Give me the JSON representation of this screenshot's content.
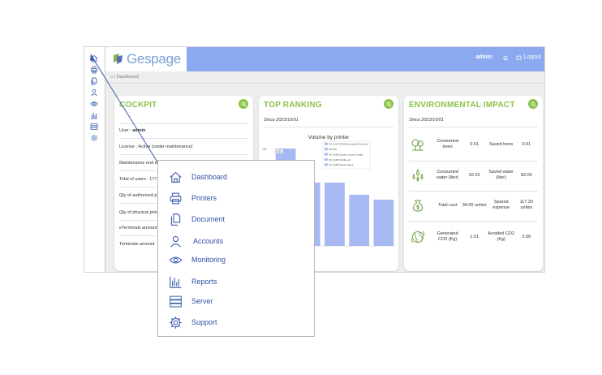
{
  "app": {
    "brand": "Gespage",
    "user": "admin",
    "logout_label": "Logout",
    "breadcrumb": "Dashboard"
  },
  "rail_icons": [
    "home-icon",
    "printer-icon",
    "document-icon",
    "user-icon",
    "eye-icon",
    "reports-icon",
    "server-icon",
    "gear-icon"
  ],
  "cockpit": {
    "title": "COCKPIT",
    "rows": [
      "User : admin",
      "License : Active (under maintenance)",
      "Maintenance end d",
      "Total of users : 177",
      "Qty of authorized p",
      "Qty of physical prin",
      "eTerminals amount",
      "Terminals amount"
    ]
  },
  "ranking": {
    "title": "TOP RANKING",
    "since": "Since 2023/10/01",
    "chart_title": "Volume by printer"
  },
  "chart_data": {
    "type": "bar",
    "title": "Volume by printer",
    "y_ticks_visible": [
      "40",
      "35"
    ],
    "bar_label": "5.33",
    "legend": [
      "PC_0127\\ EPSON Universal Print Driver",
      "EPSON",
      "PC_0108\\ Copieur_Accueil_Gratuit",
      "PC_0108\\ Toshiba_all",
      "PC_0108\\ Copieur Steve"
    ],
    "values": [
      40,
      26,
      26,
      21,
      19
    ],
    "color": "#a6b9f3"
  },
  "environment": {
    "title": "ENVIRONMENTAL IMPACT",
    "since": "Since 2023/10/01",
    "rows": [
      {
        "icon": "trees-icon",
        "label1": "Consumed trees",
        "value1": "0.01",
        "label2": "Saved trees",
        "value2": "0.01"
      },
      {
        "icon": "water-icon",
        "label1": "Consumed water (liter)",
        "value1": "32.20",
        "label2": "Saved water (liter)",
        "value2": "83.00"
      },
      {
        "icon": "money-bag-icon",
        "label1": "Total cost",
        "value1": "34.00 unites",
        "label2": "Spared expense",
        "value2": "117.20 unites"
      },
      {
        "icon": "globe-co2-icon",
        "label1": "Generated CO2 (Kg)",
        "value1": "1.01",
        "label2": "Avoided CO2 (Kg)",
        "value2": "2.08"
      }
    ]
  },
  "menu": {
    "items": [
      {
        "icon": "home-icon",
        "label": "Dashboard"
      },
      {
        "icon": "printer-icon",
        "label": "Printers"
      },
      {
        "icon": "document-icon",
        "label": "Document"
      },
      {
        "icon": "user-icon",
        "label": "Accounts"
      },
      {
        "icon": "eye-icon",
        "label": "Monitoring"
      },
      {
        "icon": "reports-icon",
        "label": "Reports"
      },
      {
        "icon": "server-icon",
        "label": "Server"
      },
      {
        "icon": "gear-icon",
        "label": "Support"
      }
    ]
  },
  "colors": {
    "accent_green": "#8bc34a",
    "header_blue": "#8aa9ef",
    "menu_text": "#2f4fa8",
    "arrow": "#3c5db0"
  }
}
